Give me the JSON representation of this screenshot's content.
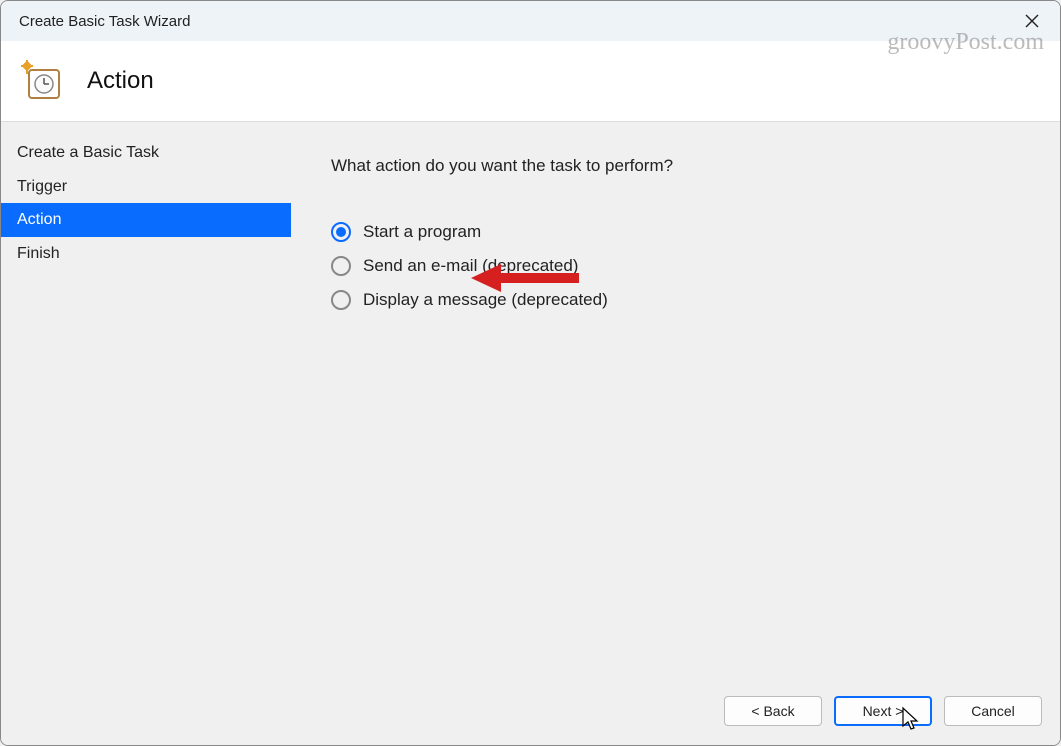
{
  "window": {
    "title": "Create Basic Task Wizard"
  },
  "header": {
    "title": "Action"
  },
  "sidebar": {
    "items": [
      {
        "label": "Create a Basic Task",
        "active": false
      },
      {
        "label": "Trigger",
        "active": false
      },
      {
        "label": "Action",
        "active": true
      },
      {
        "label": "Finish",
        "active": false
      }
    ]
  },
  "main": {
    "prompt": "What action do you want the task to perform?",
    "options": [
      {
        "label": "Start a program",
        "checked": true
      },
      {
        "label": "Send an e-mail (deprecated)",
        "checked": false
      },
      {
        "label": "Display a message (deprecated)",
        "checked": false
      }
    ]
  },
  "footer": {
    "back": "< Back",
    "next": "Next >",
    "cancel": "Cancel"
  },
  "watermark": "groovyPost.com"
}
